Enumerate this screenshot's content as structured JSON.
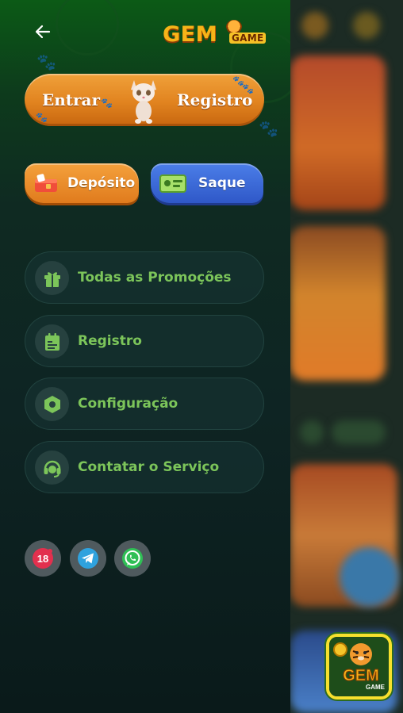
{
  "header": {
    "back_icon": "arrow-left-icon",
    "logo_text": "GEM",
    "logo_sub": "GAME"
  },
  "auth": {
    "login_label": "Entrar",
    "register_label": "Registro"
  },
  "wallet": {
    "deposit_label": "Depósito",
    "withdraw_label": "Saque"
  },
  "menu": {
    "items": [
      {
        "label": "Todas as Promoções",
        "icon": "gift-icon"
      },
      {
        "label": "Registro",
        "icon": "clipboard-icon"
      },
      {
        "label": "Configuração",
        "icon": "hexagon-settings-icon"
      },
      {
        "label": "Contatar o Serviço",
        "icon": "headset-icon"
      }
    ]
  },
  "social": {
    "age_badge": "18",
    "items": [
      "age-18-icon",
      "telegram-icon",
      "whatsapp-icon"
    ]
  },
  "floating": {
    "logo_text": "GEM",
    "logo_sub": "GAME"
  },
  "colors": {
    "accent_green": "#7cc55a",
    "orange": "#e1831f",
    "blue": "#2f58c8"
  }
}
